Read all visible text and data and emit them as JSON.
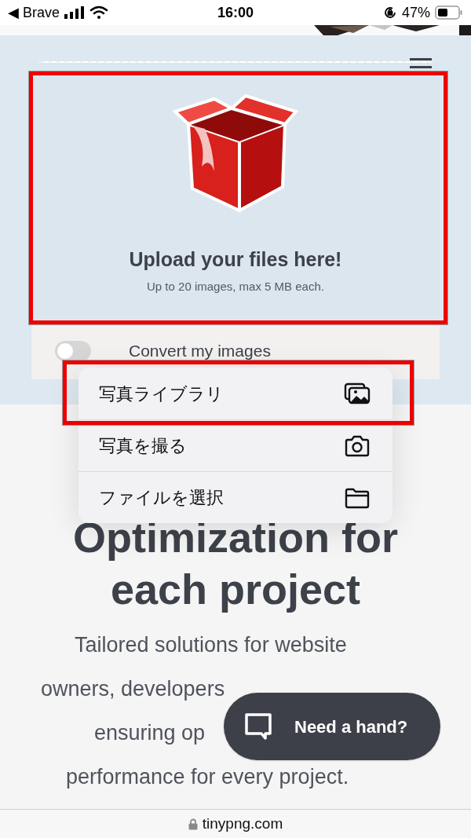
{
  "status_bar": {
    "back_app": "◀ Brave",
    "time": "16:00",
    "battery": "47%"
  },
  "upload": {
    "title": "Upload your files here!",
    "subtitle": "Up to 20 images, max 5 MB each.",
    "highlighted": true
  },
  "convert": {
    "label": "Convert my images",
    "on": false
  },
  "action_menu": [
    {
      "label": "写真ライブラリ",
      "kind": "photos",
      "highlighted": true
    },
    {
      "label": "写真を撮る",
      "kind": "camera",
      "highlighted": false
    },
    {
      "label": "ファイルを選択",
      "kind": "folder",
      "highlighted": false
    }
  ],
  "heading": "Optimization for each project",
  "paragraph_lines": [
    "Tailored solutions for website",
    "owners, developers",
    "ensuring op",
    "performance for every project."
  ],
  "chat_button": {
    "label": "Need a hand?"
  },
  "address_bar": {
    "url": "tinypng.com"
  }
}
